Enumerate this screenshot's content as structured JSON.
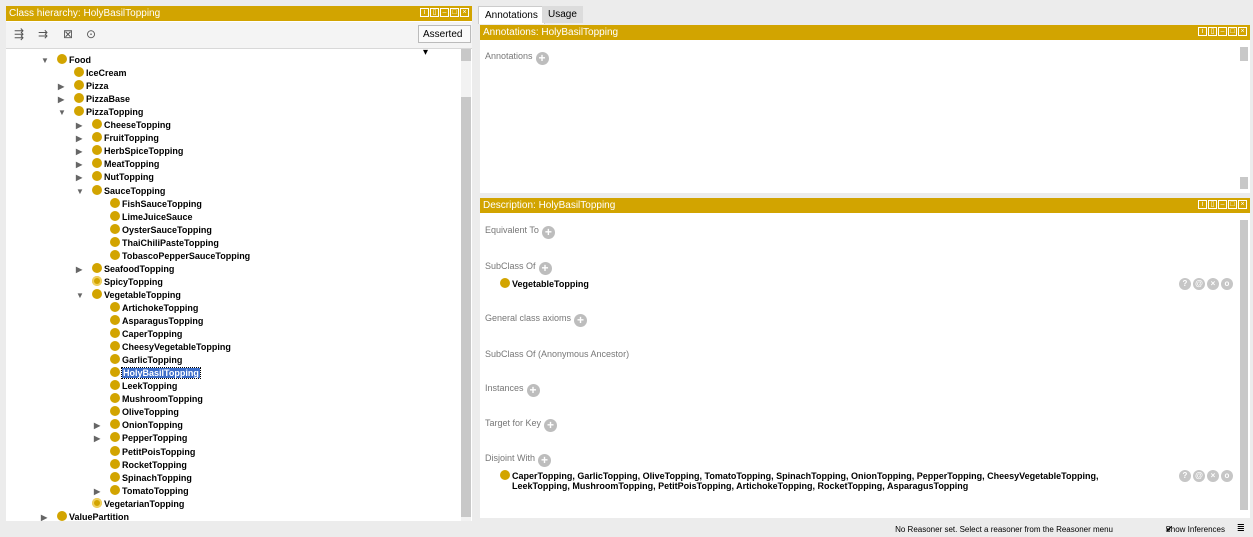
{
  "class_hierarchy": {
    "title": "Class hierarchy: HolyBasilTopping",
    "mode": "Asserted",
    "tree": [
      {
        "label": "Food",
        "depth": 0,
        "expanded": true
      },
      {
        "label": "IceCream",
        "depth": 1
      },
      {
        "label": "Pizza",
        "depth": 1,
        "collapsed": true
      },
      {
        "label": "PizzaBase",
        "depth": 1,
        "collapsed": true
      },
      {
        "label": "PizzaTopping",
        "depth": 1,
        "expanded": true
      },
      {
        "label": "CheeseTopping",
        "depth": 2,
        "collapsed": true
      },
      {
        "label": "FruitTopping",
        "depth": 2,
        "collapsed": true
      },
      {
        "label": "HerbSpiceTopping",
        "depth": 2,
        "collapsed": true
      },
      {
        "label": "MeatTopping",
        "depth": 2,
        "collapsed": true
      },
      {
        "label": "NutTopping",
        "depth": 2,
        "collapsed": true
      },
      {
        "label": "SauceTopping",
        "depth": 2,
        "expanded": true
      },
      {
        "label": "FishSauceTopping",
        "depth": 3
      },
      {
        "label": "LimeJuiceSauce",
        "depth": 3
      },
      {
        "label": "OysterSauceTopping",
        "depth": 3
      },
      {
        "label": "ThaiChiliPasteTopping",
        "depth": 3
      },
      {
        "label": "TobascoPepperSauceTopping",
        "depth": 3
      },
      {
        "label": "SeafoodTopping",
        "depth": 2,
        "collapsed": true
      },
      {
        "label": "SpicyTopping",
        "depth": 2,
        "defined": true
      },
      {
        "label": "VegetableTopping",
        "depth": 2,
        "expanded": true
      },
      {
        "label": "ArtichokeTopping",
        "depth": 3
      },
      {
        "label": "AsparagusTopping",
        "depth": 3
      },
      {
        "label": "CaperTopping",
        "depth": 3
      },
      {
        "label": "CheesyVegetableTopping",
        "depth": 3
      },
      {
        "label": "GarlicTopping",
        "depth": 3
      },
      {
        "label": "HolyBasilTopping",
        "depth": 3,
        "selected": true
      },
      {
        "label": "LeekTopping",
        "depth": 3
      },
      {
        "label": "MushroomTopping",
        "depth": 3
      },
      {
        "label": "OliveTopping",
        "depth": 3
      },
      {
        "label": "OnionTopping",
        "depth": 3,
        "collapsed": true
      },
      {
        "label": "PepperTopping",
        "depth": 3,
        "collapsed": true
      },
      {
        "label": "PetitPoisTopping",
        "depth": 3
      },
      {
        "label": "RocketTopping",
        "depth": 3
      },
      {
        "label": "SpinachTopping",
        "depth": 3
      },
      {
        "label": "TomatoTopping",
        "depth": 3,
        "collapsed": true
      },
      {
        "label": "VegetarianTopping",
        "depth": 2,
        "defined": true
      },
      {
        "label": "ValuePartition",
        "depth": 0,
        "collapsed": true
      }
    ]
  },
  "tabs": [
    "Annotations",
    "Usage"
  ],
  "annotations_panel": {
    "title": "Annotations: HolyBasilTopping",
    "label": "Annotations"
  },
  "description_panel": {
    "title": "Description: HolyBasilTopping",
    "sections": {
      "equivalent_to": "Equivalent To",
      "subclass_of": "SubClass Of",
      "subclass_value": "VegetableTopping",
      "general_axioms": "General class axioms",
      "anon_ancestor": "SubClass Of (Anonymous Ancestor)",
      "instances": "Instances",
      "target_for_key": "Target for Key",
      "disjoint_with": "Disjoint With",
      "disjoint_line1": "CaperTopping, GarlicTopping, OliveTopping, TomatoTopping, SpinachTopping, OnionTopping, PepperTopping, CheesyVegetableTopping,",
      "disjoint_line2": "LeekTopping, MushroomTopping, PetitPoisTopping, ArtichokeTopping, RocketTopping, AsparagusTopping"
    }
  },
  "status_bar": {
    "message": "No Reasoner set. Select a reasoner from the Reasoner menu",
    "show_inferences": "Show Inferences"
  },
  "colors": {
    "accent": "#d2a400",
    "selection": "#3d6ec9"
  }
}
